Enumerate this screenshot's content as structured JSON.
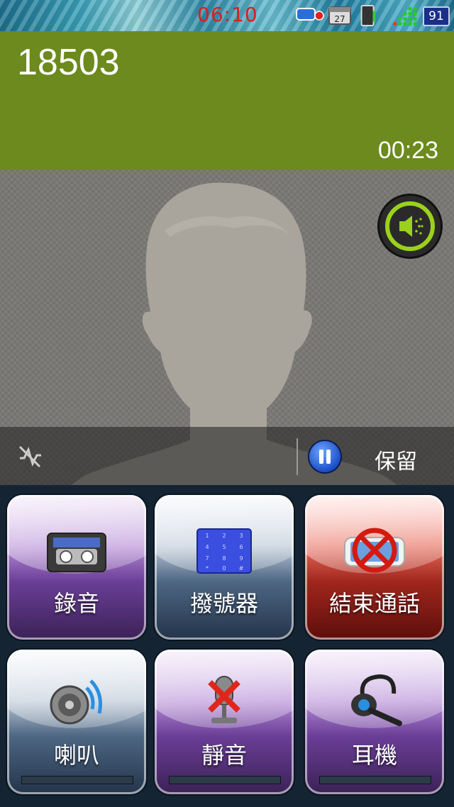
{
  "status_bar": {
    "time": "06:10",
    "battery": "91",
    "icons": [
      "phone-usb-icon",
      "calendar-icon",
      "sim-icon",
      "signal-dots-icon"
    ]
  },
  "call": {
    "number": "18503",
    "duration": "00:23",
    "speaker_toggle_icon": "speaker-icon"
  },
  "controls": {
    "mute_icon": "mic-off-icon",
    "hold_label": "保留",
    "hold_icon": "pause-icon"
  },
  "buttons": [
    {
      "label": "錄音",
      "icon": "cassette-icon",
      "style": "purple"
    },
    {
      "label": "撥號器",
      "icon": "keypad-icon",
      "style": "steel"
    },
    {
      "label": "結束通話",
      "icon": "end-call-icon",
      "style": "red"
    },
    {
      "label": "喇叭",
      "icon": "speaker-icon",
      "style": "steel"
    },
    {
      "label": "靜音",
      "icon": "mute-mic-icon",
      "style": "purple"
    },
    {
      "label": "耳機",
      "icon": "headset-icon",
      "style": "purple"
    }
  ],
  "colors": {
    "header": "#6c8a1d",
    "clock": "#d8201b",
    "speaker_ring": "#9bd11c"
  }
}
